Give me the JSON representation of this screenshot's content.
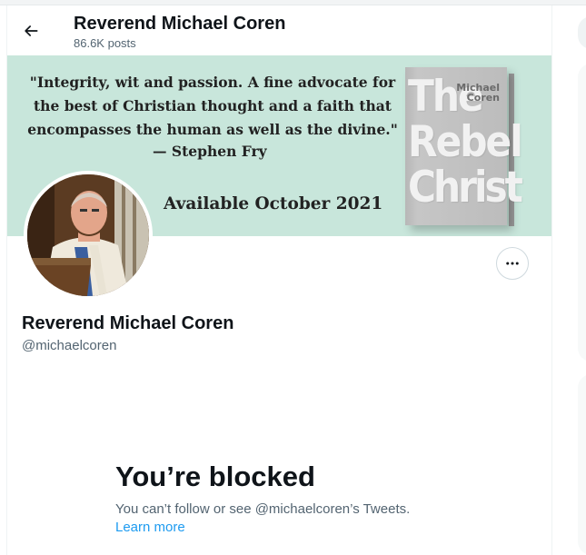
{
  "header": {
    "title": "Reverend Michael Coren",
    "posts_count": "86.6K posts",
    "back_icon": "arrow-left-icon"
  },
  "banner": {
    "quote": "\"Integrity, wit and passion. A fine advocate for the best of Christian thought and a faith that encompasses the human as well as the divine.\"",
    "attribution": "— Stephen Fry",
    "availability": "Available October 2021",
    "book_author_line1": "Michael",
    "book_author_line2": "Coren",
    "book_title_line1": "The",
    "book_title_line2": "Rebel",
    "book_title_line3": "Christ",
    "background_color": "#c8e6db"
  },
  "profile": {
    "name": "Reverend Michael Coren",
    "handle": "@michaelcoren",
    "more_icon": "more-horizontal-icon"
  },
  "blocked": {
    "title": "You’re blocked",
    "message": "You can’t follow or see @michaelcoren’s Tweets.",
    "link": "Learn more",
    "link_color": "#1d9bf0"
  }
}
